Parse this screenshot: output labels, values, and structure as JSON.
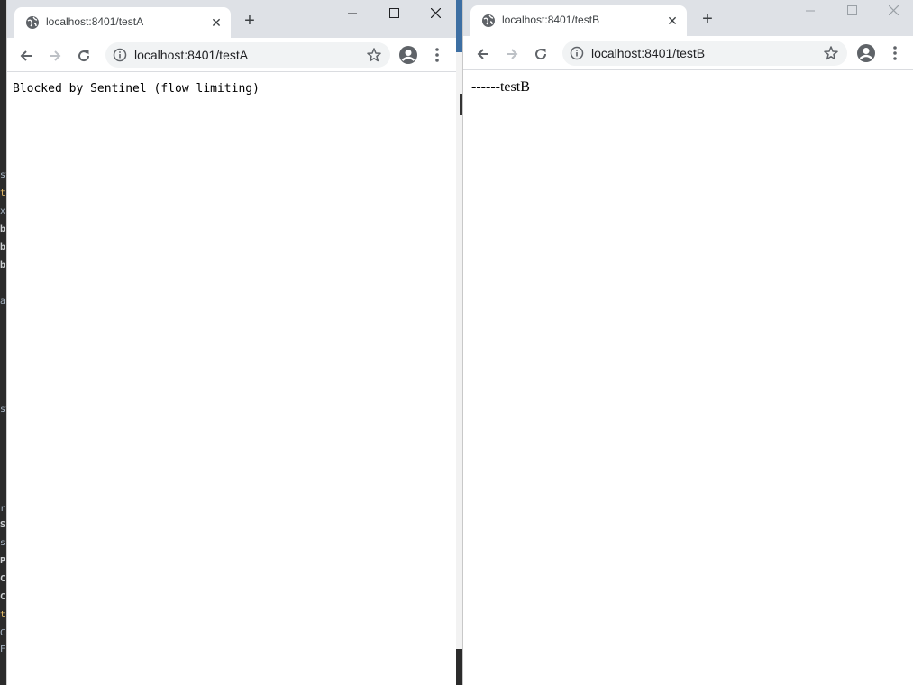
{
  "window_a": {
    "tab_title": "localhost:8401/testA",
    "url": "localhost:8401/testA",
    "page_text": "Blocked by Sentinel (flow limiting)"
  },
  "window_b": {
    "tab_title": "localhost:8401/testB",
    "url": "localhost:8401/testB",
    "page_text": "------testB"
  },
  "ide_strip": {
    "chars": [
      "st",
      "t",
      "x",
      "b",
      "b",
      "b",
      "a",
      "st",
      "r",
      "S",
      "s",
      "P",
      "C",
      "C",
      "t",
      "C",
      "F"
    ]
  },
  "icons": {
    "tab_favicon": "globe-icon",
    "tab_close": "close-icon",
    "new_tab": "plus-icon",
    "back": "arrow-left-icon",
    "forward": "arrow-right-icon",
    "reload": "reload-icon",
    "site_info": "info-icon",
    "bookmark": "star-icon",
    "profile": "profile-icon",
    "menu": "kebab-menu-icon",
    "minimize": "minimize-icon",
    "maximize": "maximize-icon",
    "window_close": "window-close-icon"
  },
  "colors": {
    "tab_strip": "#dee1e6",
    "omnibox": "#f1f3f4",
    "icon": "#5f6368"
  }
}
